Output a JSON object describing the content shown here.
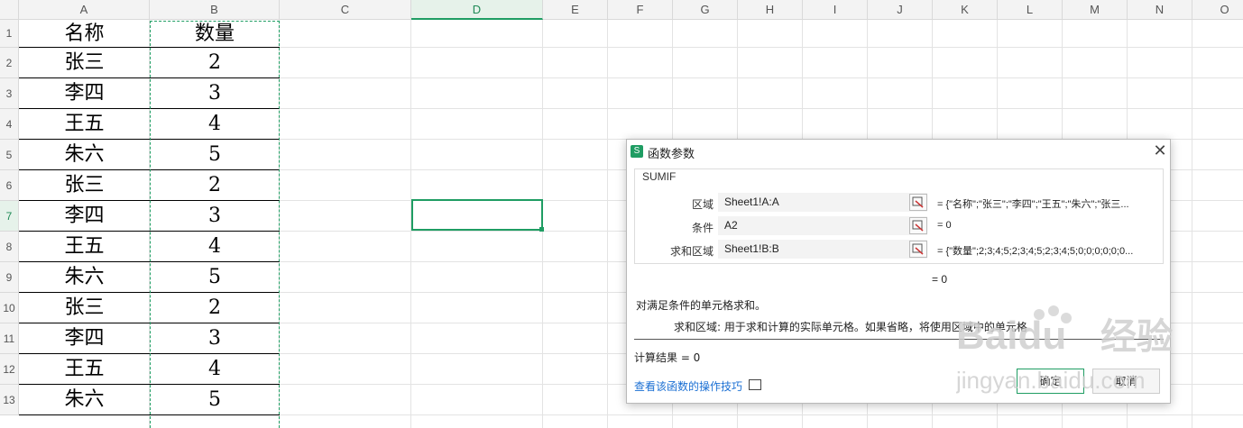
{
  "columns": [
    "A",
    "B",
    "C",
    "D",
    "E",
    "F",
    "G",
    "H",
    "I",
    "J",
    "K",
    "L",
    "M",
    "N",
    "O"
  ],
  "rows": [
    "1",
    "2",
    "3",
    "4",
    "5",
    "6",
    "7",
    "8",
    "9",
    "10",
    "11",
    "12",
    "13"
  ],
  "active_column": "D",
  "active_row": "7",
  "table": {
    "header": {
      "name": "名称",
      "qty": "数量"
    },
    "data": [
      {
        "name": "张三",
        "qty": "2"
      },
      {
        "name": "李四",
        "qty": "3"
      },
      {
        "name": "王五",
        "qty": "4"
      },
      {
        "name": "朱六",
        "qty": "5"
      },
      {
        "name": "张三",
        "qty": "2"
      },
      {
        "name": "李四",
        "qty": "3"
      },
      {
        "name": "王五",
        "qty": "4"
      },
      {
        "name": "朱六",
        "qty": "5"
      },
      {
        "name": "张三",
        "qty": "2"
      },
      {
        "name": "李四",
        "qty": "3"
      },
      {
        "name": "王五",
        "qty": "4"
      },
      {
        "name": "朱六",
        "qty": "5"
      }
    ]
  },
  "dialog": {
    "icon_letter": "S",
    "title": "函数参数",
    "close": "✕",
    "function_name": "SUMIF",
    "params": [
      {
        "label": "区域",
        "value": "Sheet1!A:A",
        "result": "= {\"名称\";\"张三\";\"李四\";\"王五\";\"朱六\";\"张三..."
      },
      {
        "label": "条件",
        "value": "A2",
        "result": "= 0"
      },
      {
        "label": "求和区域",
        "value": "Sheet1!B:B",
        "result": "= {\"数量\";2;3;4;5;2;3;4;5;2;3;4;5;0;0;0;0;0;0..."
      }
    ],
    "formula_result": "= 0",
    "description": "对满足条件的单元格求和。",
    "arg_description": "求和区域:   用于求和计算的实际单元格。如果省略，将使用区域中的单元格",
    "calc_result": "计算结果 = 0",
    "help_link": "查看该函数的操作技巧",
    "ok_label": "确定",
    "cancel_label": "取消"
  },
  "watermark": {
    "brand": "Baidu",
    "cn": "经验",
    "url": "jingyan.baidu.com"
  },
  "colors": {
    "accent": "#1f9d63",
    "link": "#1a6fd3"
  }
}
